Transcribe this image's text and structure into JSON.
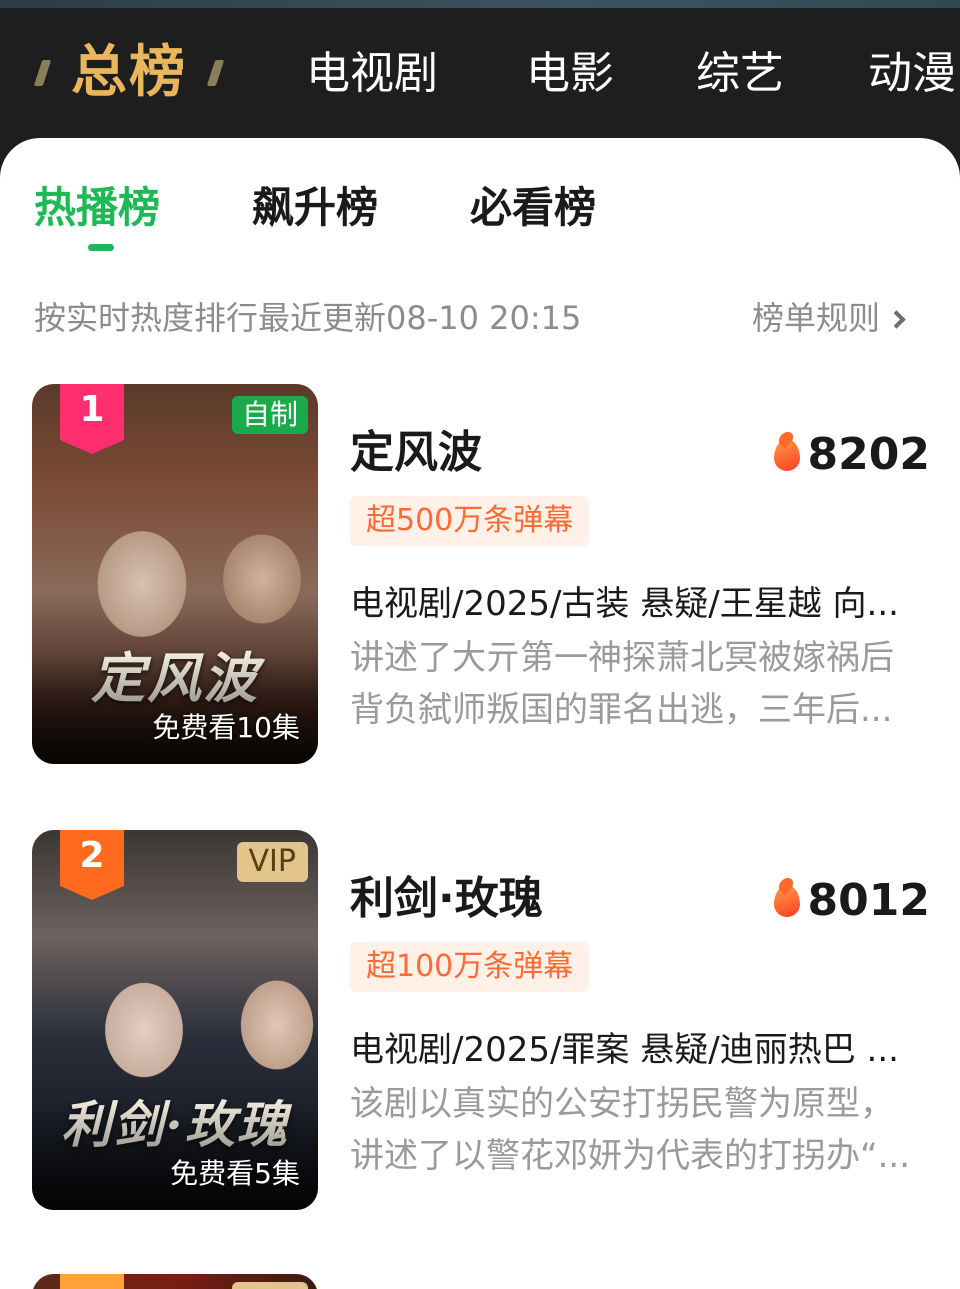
{
  "top_nav": {
    "active": "总榜",
    "items": [
      "电视剧",
      "电影",
      "综艺",
      "动漫"
    ]
  },
  "sub_tabs": {
    "items": [
      "热播榜",
      "飙升榜",
      "必看榜"
    ],
    "active_index": 0
  },
  "info": {
    "text": "按实时热度排行最近更新08-10 20:15",
    "rules_link": "榜单规则"
  },
  "colors": {
    "accent_green": "#1db954",
    "gold": "#e9b65b",
    "rank_1": "#ff2e6e",
    "rank_2": "#ff6a1f",
    "danmu_text": "#ff6a33"
  },
  "items": [
    {
      "rank": "1",
      "title": "定风波",
      "poster_title": "定风波",
      "poster_tag": "自制",
      "free_episodes": "免费看10集",
      "heat": "8202",
      "heat_icon": "flame-icon",
      "danmu": "超500万条弹幕",
      "meta": "电视剧/2025/古装 悬疑/王星越 向...",
      "description": "讲述了大亓第一神探萧北冥被嫁祸后背负弑师叛国的罪名出逃，三年后..."
    },
    {
      "rank": "2",
      "title": "利剑·玫瑰",
      "poster_title": "利剑·玫瑰",
      "poster_tag": "VIP",
      "free_episodes": "免费看5集",
      "heat": "8012",
      "heat_icon": "flame-icon",
      "danmu": "超100万条弹幕",
      "meta": "电视剧/2025/罪案 悬疑/迪丽热巴 ...",
      "description": "该剧以真实的公安打拐民警为原型，讲述了以警花邓妍为代表的打拐办“..."
    }
  ]
}
